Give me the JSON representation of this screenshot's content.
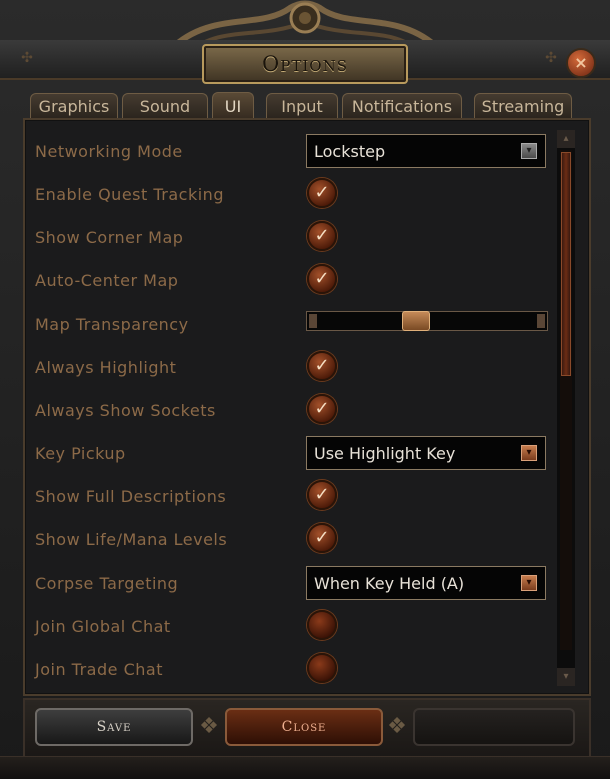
{
  "window": {
    "title": "Options",
    "close_glyph": "×"
  },
  "tabs": [
    {
      "label": "Graphics",
      "active": false
    },
    {
      "label": "Sound",
      "active": false
    },
    {
      "label": "UI",
      "active": true
    },
    {
      "label": "Input",
      "active": false
    },
    {
      "label": "Notifications",
      "active": false
    },
    {
      "label": "Streaming",
      "active": false
    }
  ],
  "settings": [
    {
      "label": "Networking Mode",
      "type": "select",
      "value": "Lockstep",
      "arrow_color": "#8a8a8a"
    },
    {
      "label": "Enable Quest Tracking",
      "type": "checkbox",
      "checked": true
    },
    {
      "label": "Show Corner Map",
      "type": "checkbox",
      "checked": true
    },
    {
      "label": "Auto-Center Map",
      "type": "checkbox",
      "checked": true
    },
    {
      "label": "Map Transparency",
      "type": "slider",
      "value": 0.45
    },
    {
      "label": "Always Highlight",
      "type": "checkbox",
      "checked": true
    },
    {
      "label": "Always Show Sockets",
      "type": "checkbox",
      "checked": true
    },
    {
      "label": "Key Pickup",
      "type": "select",
      "value": "Use Highlight Key",
      "arrow_color": "#c77d4e"
    },
    {
      "label": "Show Full Descriptions",
      "type": "checkbox",
      "checked": true
    },
    {
      "label": "Show Life/Mana Levels",
      "type": "checkbox",
      "checked": true
    },
    {
      "label": "Corpse Targeting",
      "type": "select",
      "value": "When Key Held (A)",
      "arrow_color": "#c77d4e"
    },
    {
      "label": "Join Global Chat",
      "type": "checkbox",
      "checked": false
    },
    {
      "label": "Join Trade Chat",
      "type": "checkbox",
      "checked": false
    }
  ],
  "check_glyph": "✓",
  "arrow_glyph": "▾",
  "buttons": {
    "save": "Save",
    "close": "Close"
  },
  "colors": {
    "label": "#8c6a48",
    "accent": "#a2502a",
    "border": "#8b7a62"
  }
}
